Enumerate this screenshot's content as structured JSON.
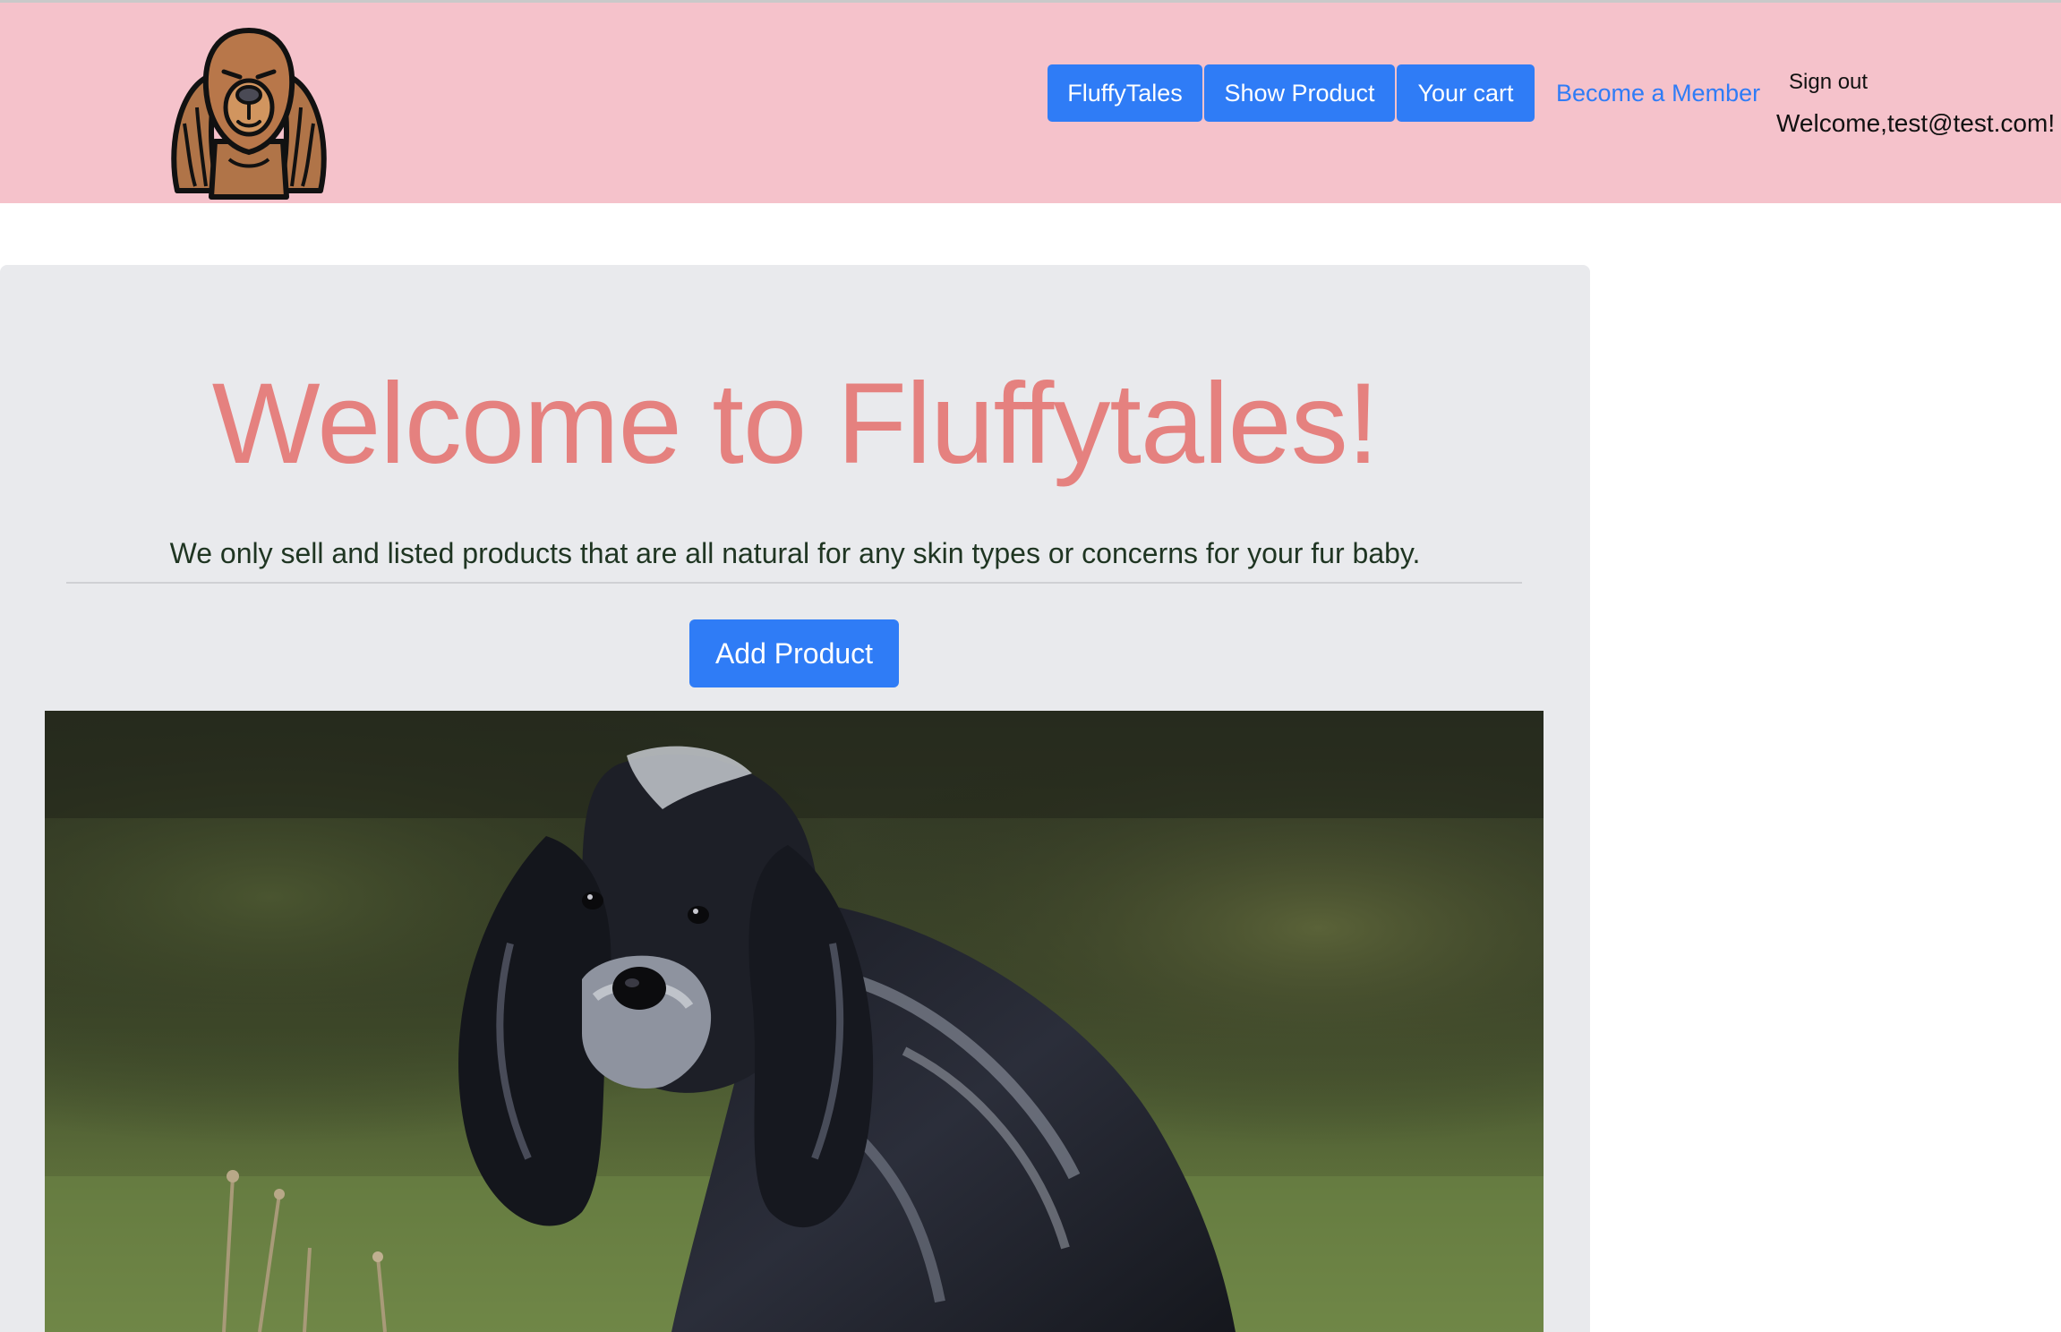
{
  "nav": {
    "buttons": [
      "FluffyTales",
      "Show Product",
      "Your cart"
    ],
    "member_link": "Become a Member",
    "sign_out": "Sign out",
    "welcome_user": "Welcome,test@test.com!"
  },
  "hero": {
    "title": "Welcome to Fluffytales!",
    "subtitle": "We only sell and listed products that are all natural for any skin types or concerns for your fur baby.",
    "add_button": "Add Product"
  },
  "colors": {
    "navbar_bg": "#f5c2cb",
    "primary": "#2f7cf6",
    "title": "#e5817f",
    "jumbotron_bg": "#e9eaed"
  },
  "icons": {
    "logo": "dog-logo-icon"
  }
}
